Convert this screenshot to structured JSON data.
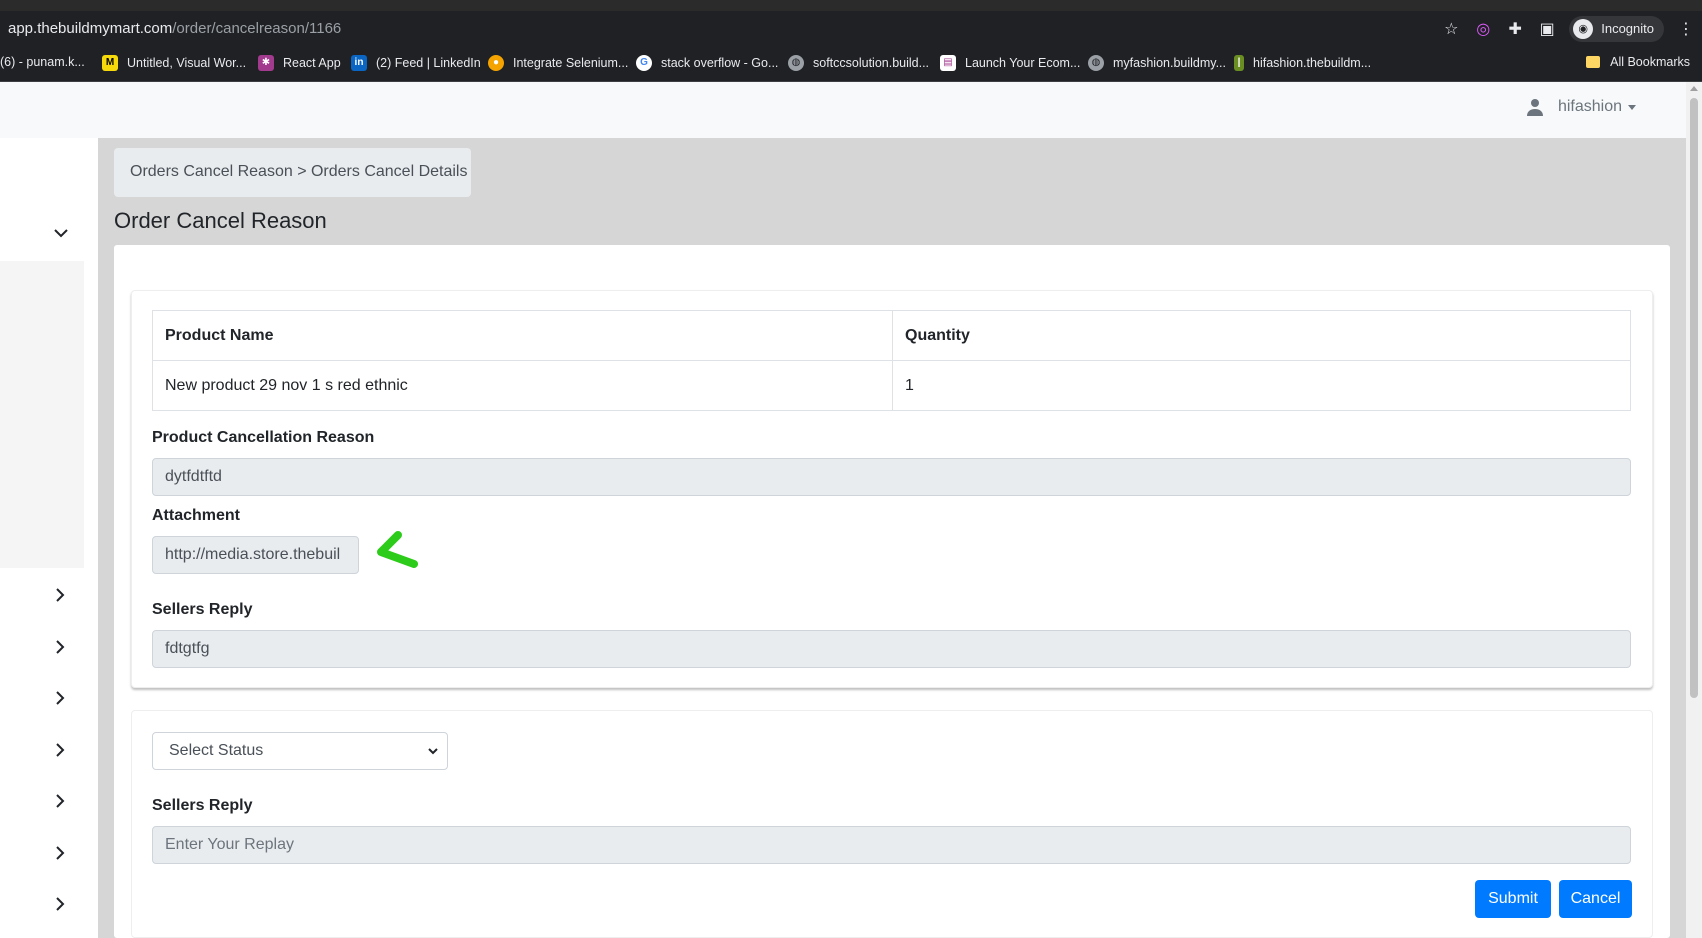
{
  "browser": {
    "url_host": "app.thebuildmymart.com",
    "url_path": "/order/cancelreason/1166",
    "incognito_label": "Incognito",
    "bookmarks": [
      {
        "label": "(6) - punam.k..."
      },
      {
        "label": "Untitled, Visual Wor..."
      },
      {
        "label": "React App"
      },
      {
        "label": "(2) Feed | LinkedIn"
      },
      {
        "label": "Integrate Selenium..."
      },
      {
        "label": "stack overflow - Go..."
      },
      {
        "label": "softccsolution.build..."
      },
      {
        "label": "Launch Your Ecom..."
      },
      {
        "label": "myfashion.buildmy..."
      },
      {
        "label": "hifashion.thebuildm..."
      }
    ],
    "all_bookmarks": "All Bookmarks"
  },
  "header": {
    "username": "hifashion"
  },
  "breadcrumb": {
    "text": "Orders Cancel Reason > Orders Cancel Details"
  },
  "page_title": "Order Cancel Reason",
  "table": {
    "headers": [
      "Product Name",
      "Quantity"
    ],
    "rows": [
      [
        "New product 29 nov 1 s red ethnic",
        "1"
      ]
    ]
  },
  "details": {
    "cancellation_label": "Product Cancellation Reason",
    "cancellation_value": "dytfdtftd",
    "attachment_label": "Attachment",
    "attachment_value": "http://media.store.thebuil",
    "sellers_reply_label": "Sellers Reply",
    "sellers_reply_value": "fdtgtfg"
  },
  "form": {
    "status_select_value": "Select Status",
    "reply_label": "Sellers Reply",
    "reply_placeholder": "Enter Your Replay",
    "submit_label": "Submit",
    "cancel_label": "Cancel"
  },
  "colors": {
    "primary": "#007bff",
    "annotation_arrow": "#2ecc1a"
  }
}
